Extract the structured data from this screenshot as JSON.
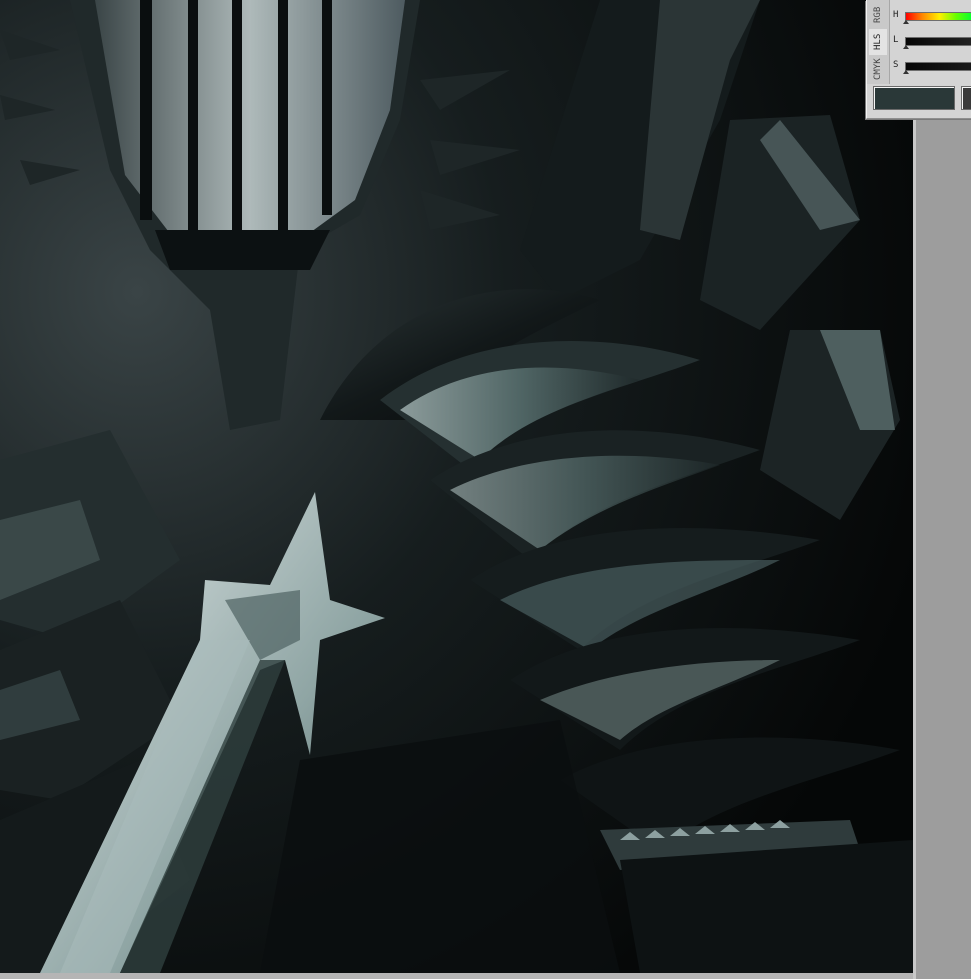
{
  "color_panel": {
    "tabs": [
      {
        "label": "RGB",
        "active": false
      },
      {
        "label": "HLS",
        "active": true
      },
      {
        "label": "CMYK",
        "active": false
      }
    ],
    "sliders": [
      {
        "label": "H",
        "gradient": "hue",
        "value": 0
      },
      {
        "label": "L",
        "gradient": "dark",
        "value": 0
      },
      {
        "label": "S",
        "gradient": "dark",
        "value": 0
      }
    ],
    "swatches": [
      {
        "name": "current-color",
        "color": "#2a3838"
      },
      {
        "name": "previous-color",
        "color": "#3a3a3a"
      }
    ]
  },
  "canvas": {
    "subject": "dark armored knight artwork",
    "palette": {
      "dark": "#070a0b",
      "mid": "#2d3a3b",
      "highlight": "#b9c9c8",
      "teal": "#6f8d8b"
    }
  }
}
